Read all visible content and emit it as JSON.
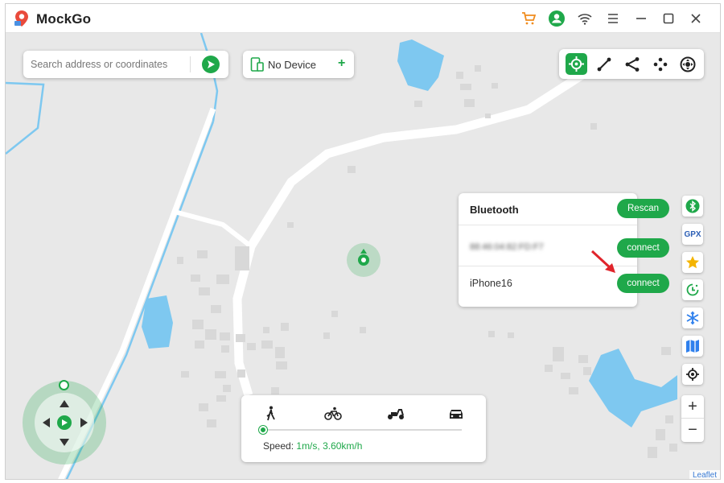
{
  "app": {
    "name": "MockGo"
  },
  "colors": {
    "brand": "#1fa84a",
    "cart": "#f08c1e",
    "water": "#7ec8f0"
  },
  "titlebar": {
    "icons": [
      "cart-icon",
      "account-icon",
      "wifi-icon",
      "menu-icon",
      "minimize-icon",
      "maximize-icon",
      "close-icon"
    ]
  },
  "search": {
    "placeholder": "Search address or coordinates"
  },
  "device": {
    "label": "No Device",
    "add": "+"
  },
  "modes": [
    "teleport-mode-icon",
    "two-spot-mode-icon",
    "multi-spot-mode-icon",
    "jump-mode-icon",
    "joystick-mode-icon"
  ],
  "bluetooth": {
    "title": "Bluetooth",
    "rescan": "Rescan",
    "devices": [
      {
        "name": "88:46:04:82:FD:F7",
        "action": "connect"
      },
      {
        "name": "iPhone16",
        "action": "connect"
      }
    ]
  },
  "sidebar": [
    "bluetooth-icon",
    "gpx-icon",
    "favorites-star-icon",
    "history-icon",
    "freeze-icon",
    "map-style-icon",
    "locate-icon"
  ],
  "sidebar_gpx": "GPX",
  "zoom": {
    "in": "+",
    "out": "−"
  },
  "speed": {
    "label": "Speed:",
    "value": "1m/s, 3.60km/h",
    "slider_fraction": 0.0,
    "modes": [
      "walk-icon",
      "bike-icon",
      "scooter-icon",
      "car-icon"
    ]
  },
  "attribution": "Leaflet"
}
